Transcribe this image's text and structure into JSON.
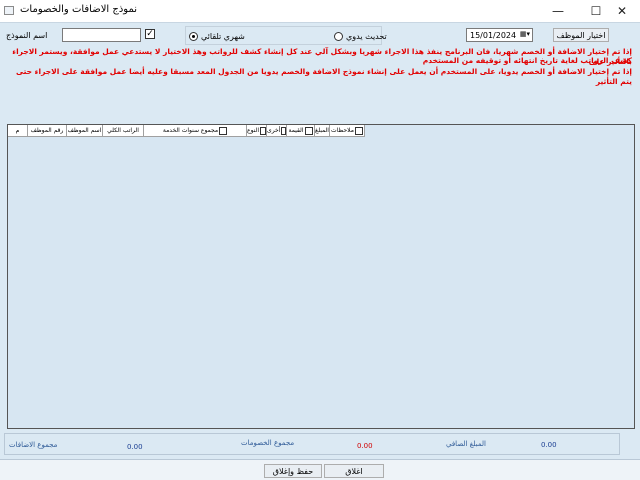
{
  "window": {
    "title": "نموذج الاضافات والخصومات",
    "minimize": "—",
    "maximize": "☐",
    "close": "✕"
  },
  "toolbar": {
    "select_employee": "اختيار الموظف",
    "date_value": "15/01/2024",
    "manual_update": "تحديث يدوي",
    "auto_monthly": "شهري تلقائي",
    "template_name_label": "اسم النموذج",
    "template_name_value": "",
    "checkbox_mark": "✓"
  },
  "notes": {
    "line1": "إذا تم إختيار الاضافة أو الخصم شهريا، فان البرنامج ينفذ هذا الاجراء شهريا وبشكل آلي عند كل إنشاء كشف للرواتب وهذ الاختيار لا يستدعي عمل موافقة، ويستمر الاجراء بالتأثير على",
    "line2": "كشف الرواتب لغاية تاريخ انتهائه أو توقيفه من المستخدم",
    "line3": "إذا تم إختيار الاضافة أو الخصم يدويا، على المستخدم أن يعمل على إنشاء نموذج الاضافة والخصم يدويا من الجدول المعد مسبقا وعليه أيضا عمل موافقة على الاجراء حتى يتم التأثير"
  },
  "grid": {
    "columns": [
      {
        "label": "ملاحظات",
        "checkbox": true
      },
      {
        "label": "المبلغ",
        "checkbox": false
      },
      {
        "label": "القيمة",
        "checkbox": true
      },
      {
        "label": "أخرى",
        "checkbox": true
      },
      {
        "label": "النوع",
        "checkbox": true
      },
      {
        "label": "مجموع سنوات الخدمة",
        "checkbox": true
      },
      {
        "label": "الراتب الكلي",
        "checkbox": false
      },
      {
        "label": "اسم الموظف",
        "checkbox": false
      },
      {
        "label": "رقم الموظف",
        "checkbox": false
      },
      {
        "label": "م",
        "checkbox": false
      }
    ]
  },
  "totals": {
    "additions_label": "مجموع الاضافات",
    "additions_value": "0.00",
    "deductions_label": "مجموع الخصومات",
    "deductions_value": "0.00",
    "net_label": "المبلغ الصافي",
    "net_value": "0.00"
  },
  "actions": {
    "close": "اغلاق",
    "save_close": "حفظ وإغلاق"
  },
  "colors": {
    "background": "#dbe9f3",
    "note_red": "#e20000",
    "totals_blue": "#2e5a97"
  }
}
